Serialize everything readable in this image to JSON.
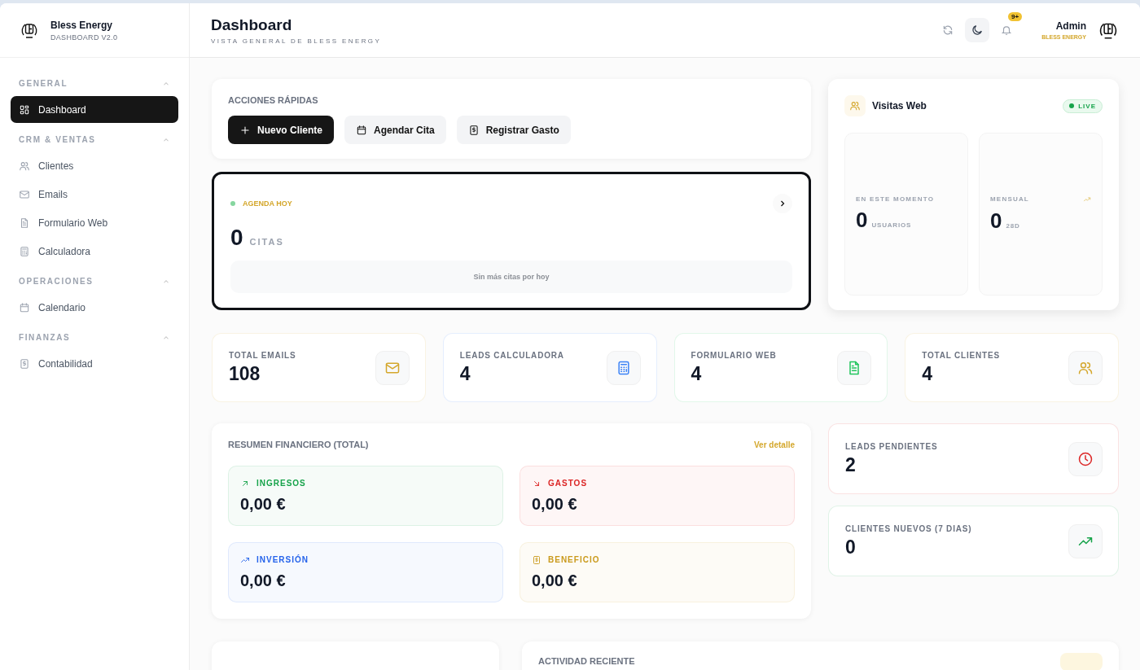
{
  "brand": {
    "name": "Bless Energy",
    "subtitle": "DASHBOARD V2.0"
  },
  "sidebar": {
    "sections": [
      {
        "title": "GENERAL",
        "expanded": true,
        "items": [
          {
            "label": "Dashboard",
            "selected": true
          }
        ]
      },
      {
        "title": "CRM & VENTAS",
        "expanded": true,
        "items": [
          {
            "label": "Clientes",
            "selected": false
          },
          {
            "label": "Emails",
            "selected": false
          },
          {
            "label": "Formulario Web",
            "selected": false
          },
          {
            "label": "Calculadora",
            "selected": false
          }
        ]
      },
      {
        "title": "OPERACIONES",
        "expanded": true,
        "items": [
          {
            "label": "Calendario",
            "selected": false
          }
        ]
      },
      {
        "title": "FINANZAS",
        "expanded": true,
        "items": [
          {
            "label": "Contabilidad",
            "selected": false
          }
        ]
      }
    ]
  },
  "header": {
    "title": "Dashboard",
    "subtitle": "VISTA GENERAL DE BLESS ENERGY",
    "notification_badge": "9+",
    "user": {
      "name": "Admin",
      "role": "BLESS ENERGY"
    }
  },
  "quick_actions": {
    "title": "ACCIONES RÁPIDAS",
    "buttons": [
      {
        "label": "Nuevo Cliente",
        "kind": "primary"
      },
      {
        "label": "Agendar Cita",
        "kind": "secondary"
      },
      {
        "label": "Registrar Gasto",
        "kind": "secondary"
      }
    ]
  },
  "agenda": {
    "title": "AGENDA HOY",
    "count": "0",
    "unit": "CITAS",
    "empty_message": "Sin más citas por hoy"
  },
  "web_visits": {
    "title": "Visitas Web",
    "badge": "LIVE",
    "stats": [
      {
        "label": "EN ESTE MOMENTO",
        "value": "0",
        "unit": "USUARIOS",
        "trend": false
      },
      {
        "label": "MENSUAL",
        "value": "0",
        "unit": "28D",
        "trend": true
      }
    ]
  },
  "stats": [
    {
      "label": "TOTAL EMAILS",
      "value": "108",
      "color": "#d4a72c"
    },
    {
      "label": "LEADS CALCULADORA",
      "value": "4",
      "color": "#3b82f6"
    },
    {
      "label": "FORMULARIO WEB",
      "value": "4",
      "color": "#22c55e"
    },
    {
      "label": "TOTAL CLIENTES",
      "value": "4",
      "color": "#d4a72c"
    }
  ],
  "finance": {
    "title": "RESUMEN FINANCIERO (TOTAL)",
    "link": "Ver detalle",
    "items": [
      {
        "label": "INGRESOS",
        "value": "0,00 €",
        "color": "#16a34a"
      },
      {
        "label": "GASTOS",
        "value": "0,00 €",
        "color": "#dc2626"
      },
      {
        "label": "INVERSIÓN",
        "value": "0,00 €",
        "color": "#2563eb"
      },
      {
        "label": "BENEFICIO",
        "value": "0,00 €",
        "color": "#ca9a1c"
      }
    ]
  },
  "side_stats": [
    {
      "label": "LEADS PENDIENTES",
      "value": "2",
      "color": "#dc2626"
    },
    {
      "label": "CLIENTES NUEVOS (7 DIAS)",
      "value": "0",
      "color": "#16a34a"
    }
  ],
  "activity": {
    "title": "ACTIVIDAD RECIENTE"
  }
}
